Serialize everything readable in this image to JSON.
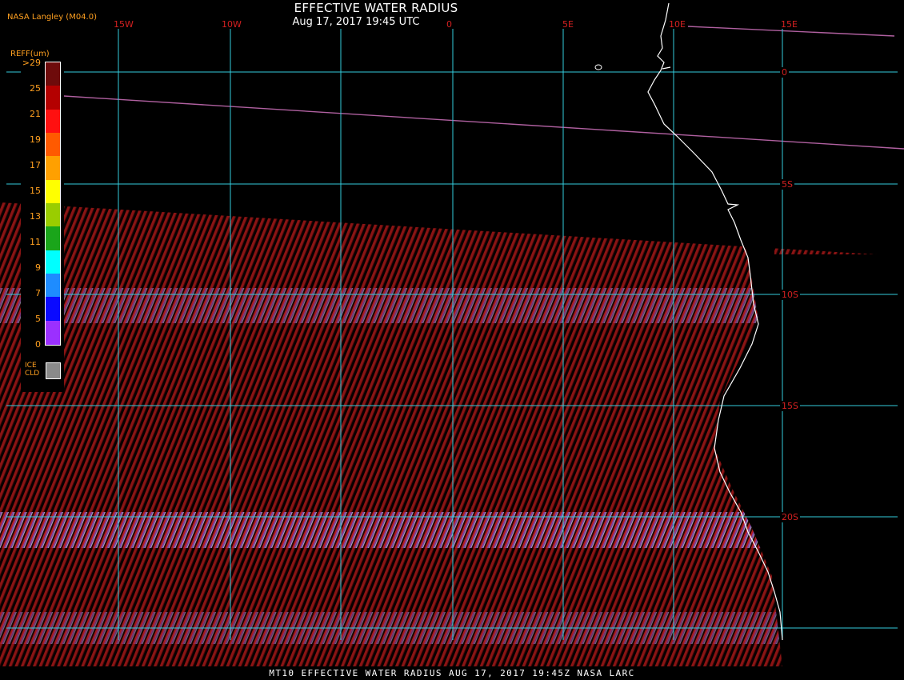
{
  "header": {
    "title": "EFFECTIVE WATER RADIUS",
    "subtitle": "Aug 17, 2017 19:45 UTC",
    "agency": "NASA Langley (M04.0)"
  },
  "footer": {
    "text": "MT10  EFFECTIVE WATER RADIUS   AUG 17, 2017 19:45Z   NASA LARC"
  },
  "legend": {
    "title": "REFF(um)",
    "ticks": [
      ">29",
      "25",
      "21",
      "19",
      "17",
      "15",
      "13",
      "11",
      "9",
      "7",
      "5",
      "0"
    ],
    "colors": [
      "#6e0b0b",
      "#b40000",
      "#ff1010",
      "#ff5a00",
      "#ffa000",
      "#ffff00",
      "#9acd00",
      "#1aa51a",
      "#00ffff",
      "#1e8cff",
      "#0a0aff",
      "#9b30ff"
    ],
    "ice_label_1": "ICE",
    "ice_label_2": "CLD",
    "ice_color": "#8a8a8a"
  },
  "grid": {
    "longitudes": [
      "15W",
      "10W",
      "0",
      "5E",
      "10E",
      "15E"
    ],
    "latitudes": [
      "0",
      "5S",
      "10S",
      "15S",
      "20S"
    ],
    "line_color": "#33ccdd",
    "label_color": "#d42020",
    "coast_color": "#ffffff"
  }
}
